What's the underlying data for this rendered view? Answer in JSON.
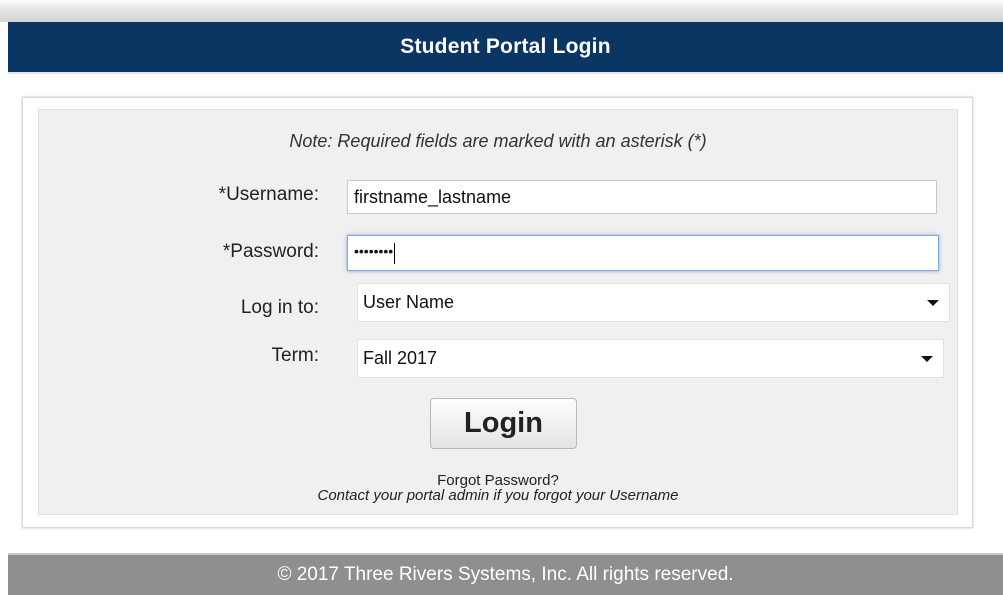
{
  "header": {
    "title": "Student Portal Login"
  },
  "form": {
    "note": "Note: Required fields are marked with an asterisk (*)",
    "username": {
      "label": "*Username:",
      "value": "firstname_lastname"
    },
    "password": {
      "label": "*Password:",
      "masked_value": "••••••••"
    },
    "login_to": {
      "label": "Log in to:",
      "selected": "User Name"
    },
    "term": {
      "label": "Term:",
      "selected": "Fall 2017"
    },
    "login_button": "Login",
    "forgot_password": "Forgot Password?",
    "contact_note": "Contact your portal admin if you forgot your Username"
  },
  "footer": {
    "copyright": "© 2017 Three Rivers Systems, Inc. All rights reserved."
  },
  "colors": {
    "header_bg": "#0b3562",
    "footer_bg": "#8f8f8f",
    "panel_bg": "#f0f0f0",
    "focus_border": "#86a8d6"
  }
}
